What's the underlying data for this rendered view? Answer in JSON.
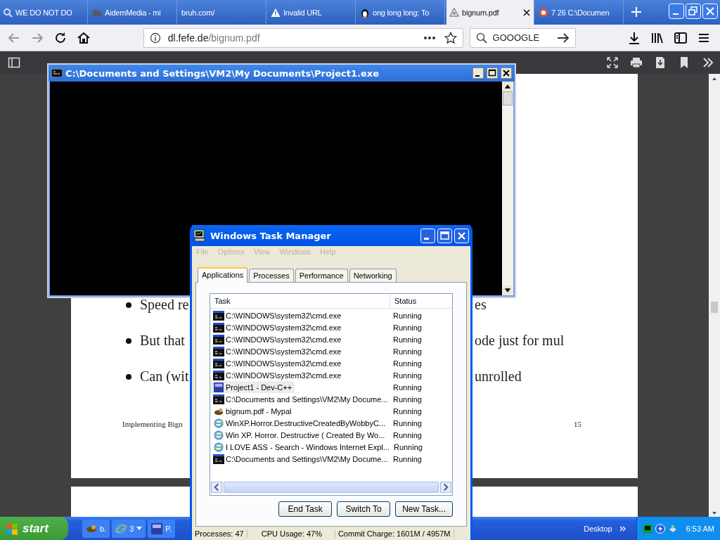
{
  "browser": {
    "tabs": [
      {
        "label": "WE DO NOT DO",
        "kind": "search",
        "selected": false
      },
      {
        "label": "AidemMedia - mi",
        "kind": "folder",
        "selected": false
      },
      {
        "label": "bruh.com/",
        "kind": "plain",
        "selected": false
      },
      {
        "label": "Invalid URL",
        "kind": "warning",
        "selected": false
      },
      {
        "label": "ong long long: To",
        "kind": "penguin",
        "selected": false
      },
      {
        "label": "bignum.pdf",
        "kind": "document",
        "selected": true
      },
      {
        "label": "7 26 C:\\Documen",
        "kind": "circle",
        "selected": false
      }
    ],
    "address": {
      "host": "dl.fefe.de",
      "path": "/bignum.pdf"
    },
    "search": {
      "value": "GOOOGLE"
    }
  },
  "pdf": {
    "bullets": [
      {
        "left": "Speed re",
        "right": "es"
      },
      {
        "left": "But that",
        "right": "ode just for mul"
      },
      {
        "left": "Can (wit",
        "right": "unrolled"
      }
    ],
    "footer": {
      "title": "Implementing Bign",
      "page": "15"
    }
  },
  "console": {
    "title": "C:\\Documents and Settings\\VM2\\My Documents\\Project1.exe"
  },
  "task_manager": {
    "title": "Windows Task Manager",
    "menu": [
      {
        "label": "File",
        "disabled": true
      },
      {
        "label": "Options",
        "disabled": true
      },
      {
        "label": "View",
        "disabled": true
      },
      {
        "label": "Windows",
        "disabled": true
      },
      {
        "label": "Help",
        "disabled": true
      }
    ],
    "tabs": [
      {
        "label": "Applications",
        "selected": true
      },
      {
        "label": "Processes",
        "selected": false
      },
      {
        "label": "Performance",
        "selected": false
      },
      {
        "label": "Networking",
        "selected": false
      }
    ],
    "columns": [
      "Task",
      "Status"
    ],
    "rows": [
      {
        "task": "C:\\WINDOWS\\system32\\cmd.exe",
        "status": "Running",
        "kind": "console",
        "selected": false
      },
      {
        "task": "C:\\WINDOWS\\system32\\cmd.exe",
        "status": "Running",
        "kind": "console",
        "selected": false
      },
      {
        "task": "C:\\WINDOWS\\system32\\cmd.exe",
        "status": "Running",
        "kind": "console",
        "selected": false
      },
      {
        "task": "C:\\WINDOWS\\system32\\cmd.exe",
        "status": "Running",
        "kind": "console",
        "selected": false
      },
      {
        "task": "C:\\WINDOWS\\system32\\cmd.exe",
        "status": "Running",
        "kind": "console",
        "selected": false
      },
      {
        "task": "C:\\WINDOWS\\system32\\cmd.exe",
        "status": "Running",
        "kind": "console",
        "selected": false
      },
      {
        "task": "Project1 - Dev-C++",
        "status": "Running",
        "kind": "ide",
        "selected": true
      },
      {
        "task": "C:\\Documents and Settings\\VM2\\My Docume...",
        "status": "Running",
        "kind": "console",
        "selected": false
      },
      {
        "task": "bignum.pdf - Mypal",
        "status": "Running",
        "kind": "animal",
        "selected": false
      },
      {
        "task": "WinXP.Horror.DestructiveCreatedByWobbyC...",
        "status": "Running",
        "kind": "browser",
        "selected": false
      },
      {
        "task": "Win XP. Horror. Destructive ( Created By Wo...",
        "status": "Running",
        "kind": "browser",
        "selected": false
      },
      {
        "task": "I LOVE ASS - Search - Windows Internet Expl...",
        "status": "Running",
        "kind": "browser",
        "selected": false
      },
      {
        "task": "C:\\Documents and Settings\\VM2\\My Docume...",
        "status": "Running",
        "kind": "console",
        "selected": false
      }
    ],
    "buttons": [
      "End Task",
      "Switch To",
      "New Task..."
    ],
    "status_bar": [
      "Processes: 47",
      "CPU Usage: 47%",
      "Commit Charge: 1601M / 4957M"
    ]
  },
  "taskbar": {
    "start": "start",
    "buttons": [
      {
        "label": "b.",
        "kind": "animal"
      },
      {
        "label": "3",
        "kind": "browser"
      },
      {
        "label": "P.",
        "kind": "ide"
      }
    ],
    "toolbar": "Desktop",
    "clock": "6:53 AM"
  }
}
